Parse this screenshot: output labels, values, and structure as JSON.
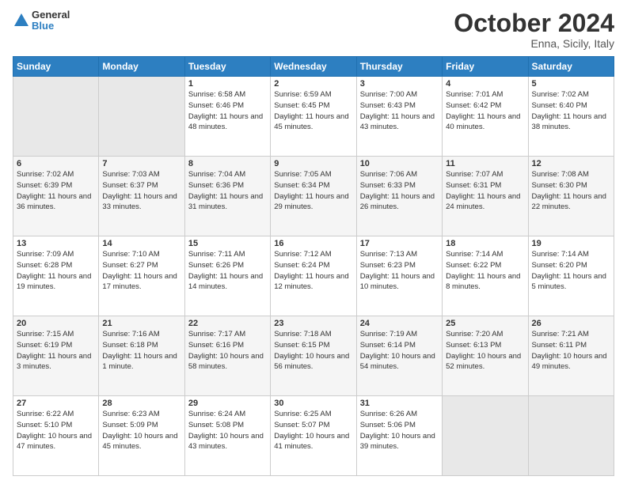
{
  "logo": {
    "line1": "General",
    "line2": "Blue"
  },
  "title": "October 2024",
  "location": "Enna, Sicily, Italy",
  "days_header": [
    "Sunday",
    "Monday",
    "Tuesday",
    "Wednesday",
    "Thursday",
    "Friday",
    "Saturday"
  ],
  "weeks": [
    [
      {
        "day": "",
        "sunrise": "",
        "sunset": "",
        "daylight": ""
      },
      {
        "day": "",
        "sunrise": "",
        "sunset": "",
        "daylight": ""
      },
      {
        "day": "1",
        "sunrise": "Sunrise: 6:58 AM",
        "sunset": "Sunset: 6:46 PM",
        "daylight": "Daylight: 11 hours and 48 minutes."
      },
      {
        "day": "2",
        "sunrise": "Sunrise: 6:59 AM",
        "sunset": "Sunset: 6:45 PM",
        "daylight": "Daylight: 11 hours and 45 minutes."
      },
      {
        "day": "3",
        "sunrise": "Sunrise: 7:00 AM",
        "sunset": "Sunset: 6:43 PM",
        "daylight": "Daylight: 11 hours and 43 minutes."
      },
      {
        "day": "4",
        "sunrise": "Sunrise: 7:01 AM",
        "sunset": "Sunset: 6:42 PM",
        "daylight": "Daylight: 11 hours and 40 minutes."
      },
      {
        "day": "5",
        "sunrise": "Sunrise: 7:02 AM",
        "sunset": "Sunset: 6:40 PM",
        "daylight": "Daylight: 11 hours and 38 minutes."
      }
    ],
    [
      {
        "day": "6",
        "sunrise": "Sunrise: 7:02 AM",
        "sunset": "Sunset: 6:39 PM",
        "daylight": "Daylight: 11 hours and 36 minutes."
      },
      {
        "day": "7",
        "sunrise": "Sunrise: 7:03 AM",
        "sunset": "Sunset: 6:37 PM",
        "daylight": "Daylight: 11 hours and 33 minutes."
      },
      {
        "day": "8",
        "sunrise": "Sunrise: 7:04 AM",
        "sunset": "Sunset: 6:36 PM",
        "daylight": "Daylight: 11 hours and 31 minutes."
      },
      {
        "day": "9",
        "sunrise": "Sunrise: 7:05 AM",
        "sunset": "Sunset: 6:34 PM",
        "daylight": "Daylight: 11 hours and 29 minutes."
      },
      {
        "day": "10",
        "sunrise": "Sunrise: 7:06 AM",
        "sunset": "Sunset: 6:33 PM",
        "daylight": "Daylight: 11 hours and 26 minutes."
      },
      {
        "day": "11",
        "sunrise": "Sunrise: 7:07 AM",
        "sunset": "Sunset: 6:31 PM",
        "daylight": "Daylight: 11 hours and 24 minutes."
      },
      {
        "day": "12",
        "sunrise": "Sunrise: 7:08 AM",
        "sunset": "Sunset: 6:30 PM",
        "daylight": "Daylight: 11 hours and 22 minutes."
      }
    ],
    [
      {
        "day": "13",
        "sunrise": "Sunrise: 7:09 AM",
        "sunset": "Sunset: 6:28 PM",
        "daylight": "Daylight: 11 hours and 19 minutes."
      },
      {
        "day": "14",
        "sunrise": "Sunrise: 7:10 AM",
        "sunset": "Sunset: 6:27 PM",
        "daylight": "Daylight: 11 hours and 17 minutes."
      },
      {
        "day": "15",
        "sunrise": "Sunrise: 7:11 AM",
        "sunset": "Sunset: 6:26 PM",
        "daylight": "Daylight: 11 hours and 14 minutes."
      },
      {
        "day": "16",
        "sunrise": "Sunrise: 7:12 AM",
        "sunset": "Sunset: 6:24 PM",
        "daylight": "Daylight: 11 hours and 12 minutes."
      },
      {
        "day": "17",
        "sunrise": "Sunrise: 7:13 AM",
        "sunset": "Sunset: 6:23 PM",
        "daylight": "Daylight: 11 hours and 10 minutes."
      },
      {
        "day": "18",
        "sunrise": "Sunrise: 7:14 AM",
        "sunset": "Sunset: 6:22 PM",
        "daylight": "Daylight: 11 hours and 8 minutes."
      },
      {
        "day": "19",
        "sunrise": "Sunrise: 7:14 AM",
        "sunset": "Sunset: 6:20 PM",
        "daylight": "Daylight: 11 hours and 5 minutes."
      }
    ],
    [
      {
        "day": "20",
        "sunrise": "Sunrise: 7:15 AM",
        "sunset": "Sunset: 6:19 PM",
        "daylight": "Daylight: 11 hours and 3 minutes."
      },
      {
        "day": "21",
        "sunrise": "Sunrise: 7:16 AM",
        "sunset": "Sunset: 6:18 PM",
        "daylight": "Daylight: 11 hours and 1 minute."
      },
      {
        "day": "22",
        "sunrise": "Sunrise: 7:17 AM",
        "sunset": "Sunset: 6:16 PM",
        "daylight": "Daylight: 10 hours and 58 minutes."
      },
      {
        "day": "23",
        "sunrise": "Sunrise: 7:18 AM",
        "sunset": "Sunset: 6:15 PM",
        "daylight": "Daylight: 10 hours and 56 minutes."
      },
      {
        "day": "24",
        "sunrise": "Sunrise: 7:19 AM",
        "sunset": "Sunset: 6:14 PM",
        "daylight": "Daylight: 10 hours and 54 minutes."
      },
      {
        "day": "25",
        "sunrise": "Sunrise: 7:20 AM",
        "sunset": "Sunset: 6:13 PM",
        "daylight": "Daylight: 10 hours and 52 minutes."
      },
      {
        "day": "26",
        "sunrise": "Sunrise: 7:21 AM",
        "sunset": "Sunset: 6:11 PM",
        "daylight": "Daylight: 10 hours and 49 minutes."
      }
    ],
    [
      {
        "day": "27",
        "sunrise": "Sunrise: 6:22 AM",
        "sunset": "Sunset: 5:10 PM",
        "daylight": "Daylight: 10 hours and 47 minutes."
      },
      {
        "day": "28",
        "sunrise": "Sunrise: 6:23 AM",
        "sunset": "Sunset: 5:09 PM",
        "daylight": "Daylight: 10 hours and 45 minutes."
      },
      {
        "day": "29",
        "sunrise": "Sunrise: 6:24 AM",
        "sunset": "Sunset: 5:08 PM",
        "daylight": "Daylight: 10 hours and 43 minutes."
      },
      {
        "day": "30",
        "sunrise": "Sunrise: 6:25 AM",
        "sunset": "Sunset: 5:07 PM",
        "daylight": "Daylight: 10 hours and 41 minutes."
      },
      {
        "day": "31",
        "sunrise": "Sunrise: 6:26 AM",
        "sunset": "Sunset: 5:06 PM",
        "daylight": "Daylight: 10 hours and 39 minutes."
      },
      {
        "day": "",
        "sunrise": "",
        "sunset": "",
        "daylight": ""
      },
      {
        "day": "",
        "sunrise": "",
        "sunset": "",
        "daylight": ""
      }
    ]
  ]
}
